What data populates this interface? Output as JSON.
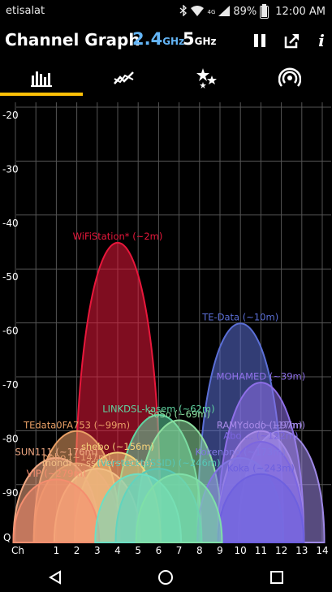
{
  "status": {
    "carrier": "etisalat",
    "battery": "89%",
    "battery_level": 0.89,
    "time": "12:00 AM",
    "network": "4G"
  },
  "header": {
    "title": "Channel Graph",
    "band_a": "2.4",
    "band_a_unit": "GHz",
    "band_b": "5",
    "band_b_unit": "GHz"
  },
  "icons": {
    "pause": "pause-icon",
    "share": "share-icon",
    "info": "info-icon",
    "info_glyph": "i"
  },
  "tabs": [
    {
      "icon": "bar-chart-icon",
      "selected": true
    },
    {
      "icon": "time-graph-icon",
      "selected": false
    },
    {
      "icon": "stars-icon",
      "selected": false
    },
    {
      "icon": "access-point-icon",
      "selected": false
    }
  ],
  "colors": {
    "accent": "#ffc107",
    "band_active": "#64b5f6",
    "grid": "#555555"
  },
  "chart_data": {
    "type": "area",
    "x_label": "Ch",
    "y_label": "Q",
    "x_ticks": [
      "1",
      "2",
      "3",
      "4",
      "5",
      "6",
      "7",
      "8",
      "9",
      "10",
      "11",
      "12",
      "13",
      "14"
    ],
    "y_ticks": [
      "-20",
      "-30",
      "-40",
      "-50",
      "-60",
      "-70",
      "-80",
      "-90"
    ],
    "xlim": [
      -1,
      15
    ],
    "ylim": [
      -100,
      -20
    ],
    "series": [
      {
        "name": "WiFiStation* (~2m)",
        "channel": 4,
        "level": -45,
        "color": "#e8173b"
      },
      {
        "name": "TE-Data (~10m)",
        "channel": 10,
        "level": -60,
        "color": "#5b6fd6"
      },
      {
        "name": "MOHAMED (~39m)",
        "channel": 11,
        "level": -71,
        "color": "#8e6fe8"
      },
      {
        "name": "LINKDSL-kasem (~62m)",
        "channel": 6,
        "level": -77,
        "color": "#5fd4a1"
      },
      {
        "name": "SoSo (~69m)",
        "channel": 7,
        "level": -78,
        "color": "#8fe0a0"
      },
      {
        "name": "TEdata0FA753 (~99m)",
        "channel": 2,
        "level": -80,
        "color": "#e9a066"
      },
      {
        "name": "RAMYdodo (~97m)",
        "channel": 11,
        "level": -80,
        "color": "#a98be9"
      },
      {
        "name": "(~117m)",
        "channel": 12,
        "level": -80,
        "color": "#9e88e6"
      },
      {
        "name": "Abo ... (~122m)",
        "channel": 11,
        "level": -82,
        "color": "#7c66e0"
      },
      {
        "name": "shebo (~156m)",
        "channel": 4,
        "level": -84,
        "color": "#f5d27a"
      },
      {
        "name": "SUN111 (~176m)",
        "channel": 1,
        "level": -85,
        "color": "#f0a883"
      },
      {
        "name": "Kokenono (~173m)",
        "channel": 10,
        "level": -85,
        "color": "#8276e2"
      },
      {
        "name": "bebo (~147m)",
        "channel": 2,
        "level": -86,
        "color": "#e6a070"
      },
      {
        "name": "mondi ... ssim (~191m)",
        "channel": 3,
        "level": -87,
        "color": "#f3c086"
      },
      {
        "name": "(VersteckteSSID) (~246m)",
        "channel": 6,
        "level": -87,
        "color": "#57c7b6"
      },
      {
        "name": "Koka (~243m)",
        "channel": 11,
        "level": -88,
        "color": "#6e60df"
      },
      {
        "name": "VIP (~279m)",
        "channel": 1,
        "level": -89,
        "color": "#f58e6f"
      },
      {
        "name": "",
        "channel": 5,
        "level": -88,
        "color": "#6cdfc4"
      },
      {
        "name": "",
        "channel": 7,
        "level": -88,
        "color": "#7fdfa8"
      }
    ]
  }
}
